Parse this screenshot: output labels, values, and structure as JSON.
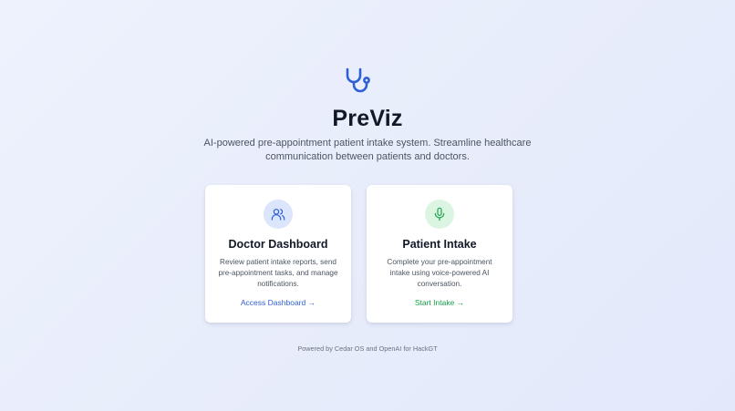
{
  "app": {
    "title": "PreViz",
    "subtitle": "AI-powered pre-appointment patient intake system. Streamline healthcare communication between patients and doctors.",
    "logo_icon": "stethoscope-icon"
  },
  "cards": [
    {
      "icon": "users-icon",
      "title": "Doctor Dashboard",
      "description": "Review patient intake reports, send pre-appointment tasks, and manage notifications.",
      "link": "Access Dashboard →",
      "accent": "#2f5fd6"
    },
    {
      "icon": "microphone-icon",
      "title": "Patient Intake",
      "description": "Complete your pre-appointment intake using voice-powered AI conversation.",
      "link": "Start Intake →",
      "accent": "#16a34a"
    }
  ],
  "footer": {
    "text": "Powered by Cedar OS and OpenAI for HackGT"
  },
  "colors": {
    "brand": "#2f5fd6",
    "patient_accent": "#16a34a",
    "background": "#e8edfb"
  }
}
